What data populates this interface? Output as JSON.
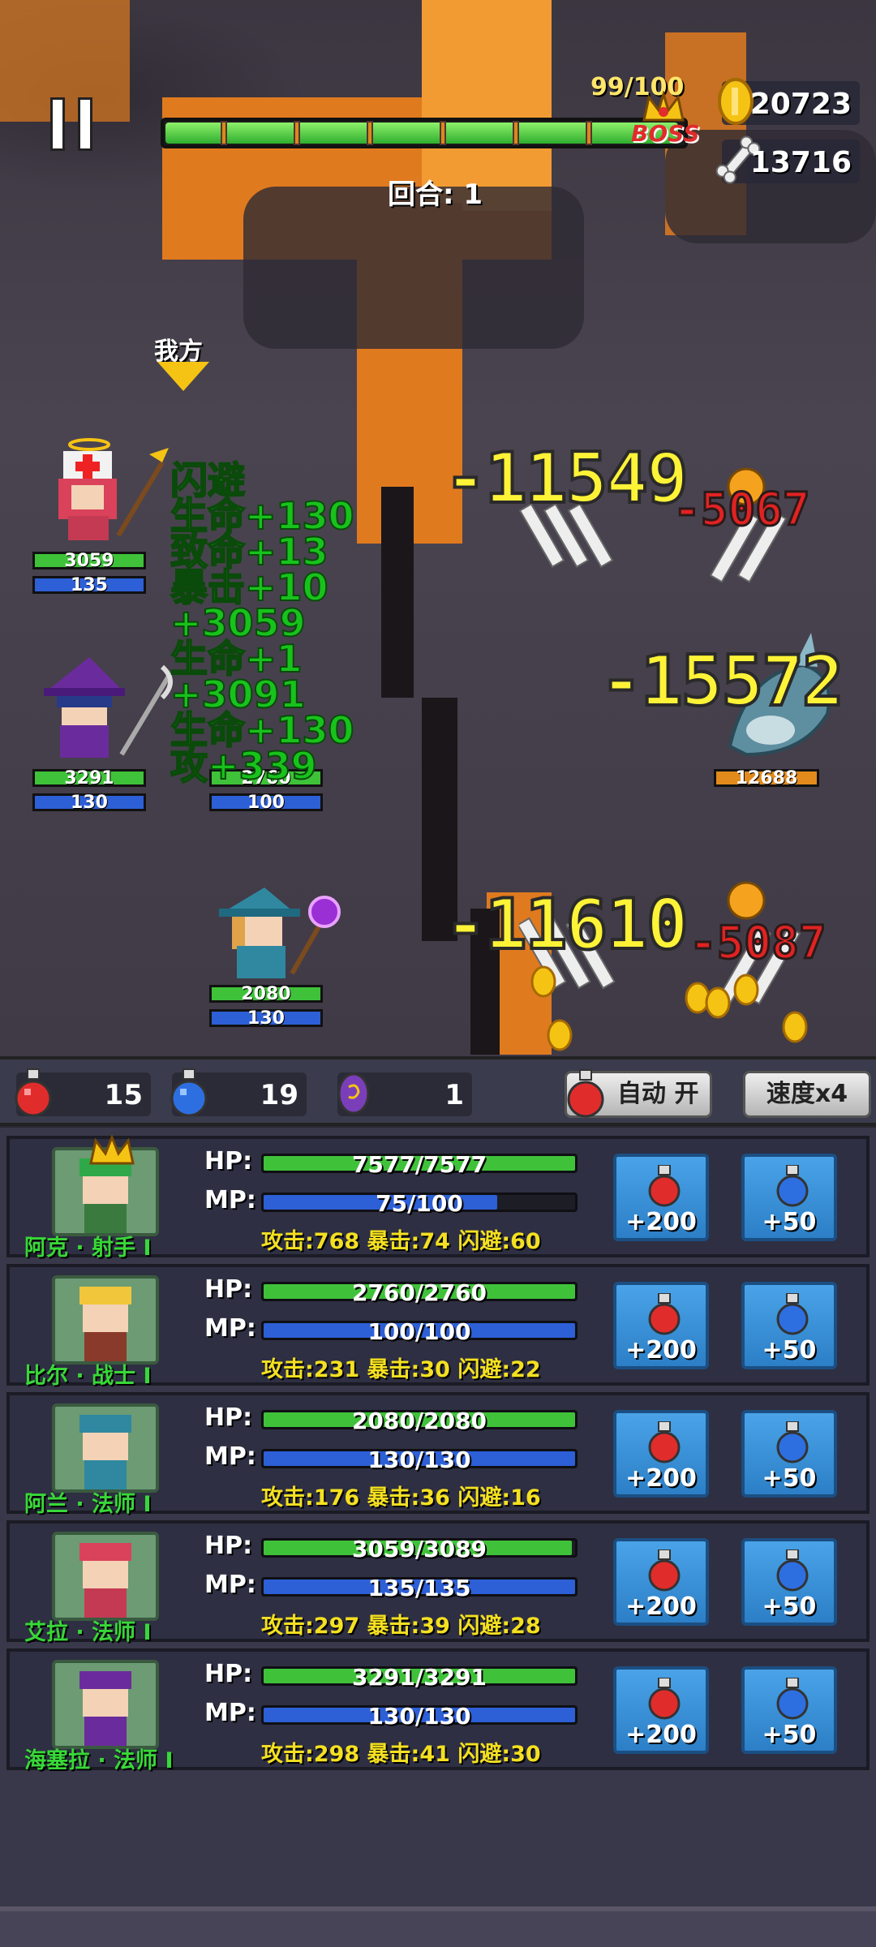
{
  "hud": {
    "boss_progress": "99/100",
    "boss_label": "BOSS",
    "boss_fill_fraction": 0.99,
    "round": "回合: 1",
    "gold": "20723",
    "bones": "13716"
  },
  "scene": {
    "our_side_label": "我方",
    "allies": [
      {
        "hp": "3059",
        "mp": "135"
      },
      {
        "hp": "3291",
        "mp": "130"
      },
      {
        "hp": "2760",
        "mp": "100"
      },
      {
        "hp": "2080",
        "mp": "130"
      }
    ],
    "enemy_hp": "12688",
    "damage": [
      "-11549",
      "-15572",
      "-11610"
    ],
    "red_damage": [
      "-5067",
      "-5087"
    ],
    "heal_float_lines": [
      "闪避",
      "生命+130",
      "致命+13",
      "暴击+10",
      "+3059",
      "生命+1",
      "+3091",
      "生命+130",
      "攻+339"
    ]
  },
  "potions": {
    "hp_count": "15",
    "mp_count": "19",
    "special_count": "1",
    "auto_label": "自动 开",
    "speed_label": "速度x4"
  },
  "heroes": [
    {
      "name": "阿克 · 射手 I",
      "hp": "7577/7577",
      "hp_frac": 1.0,
      "mp": "75/100",
      "mp_frac": 0.75,
      "stats": "攻击:768  暴击:74  闪避:60"
    },
    {
      "name": "比尔 · 战士 I",
      "hp": "2760/2760",
      "hp_frac": 1.0,
      "mp": "100/100",
      "mp_frac": 1.0,
      "stats": "攻击:231  暴击:30  闪避:22"
    },
    {
      "name": "阿兰 · 法师 I",
      "hp": "2080/2080",
      "hp_frac": 1.0,
      "mp": "130/130",
      "mp_frac": 1.0,
      "stats": "攻击:176  暴击:36  闪避:16"
    },
    {
      "name": "艾拉 · 法师 I",
      "hp": "3059/3089",
      "hp_frac": 0.99,
      "mp": "135/135",
      "mp_frac": 1.0,
      "stats": "攻击:297  暴击:39  闪避:28"
    },
    {
      "name": "海塞拉 · 法师 I",
      "hp": "3291/3291",
      "hp_frac": 1.0,
      "mp": "130/130",
      "mp_frac": 1.0,
      "stats": "攻击:298  暴击:41  闪避:30"
    }
  ],
  "labels": {
    "hp": "HP:",
    "mp": "MP:",
    "hp_potion": "+200",
    "mp_potion": "+50"
  },
  "colors": {
    "hp_bar": "#3fc23a",
    "mp_bar": "#2d5fd6",
    "gold": "#f5c313",
    "heal_text": "#18c21c",
    "damage_text": "#fff337"
  }
}
